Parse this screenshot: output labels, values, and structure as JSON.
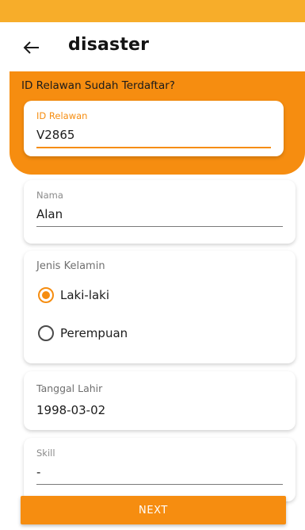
{
  "app_bar": {
    "title": "disaster"
  },
  "colors": {
    "accent": "#f68d10",
    "status_bar": "#f7ad2a"
  },
  "id_section": {
    "heading": "ID Relawan Sudah Terdaftar?",
    "field_label": "ID Relawan",
    "field_value": "V2865"
  },
  "nama": {
    "label": "Nama",
    "value": "Alan"
  },
  "jenis_kelamin": {
    "label": "Jenis Kelamin",
    "options": [
      {
        "label": "Laki-laki",
        "selected": true
      },
      {
        "label": "Perempuan",
        "selected": false
      }
    ]
  },
  "tanggal_lahir": {
    "label": "Tanggal Lahir",
    "value": "1998-03-02"
  },
  "skill": {
    "label": "Skill",
    "value": "-"
  },
  "footer": {
    "next_label": "NEXT"
  }
}
